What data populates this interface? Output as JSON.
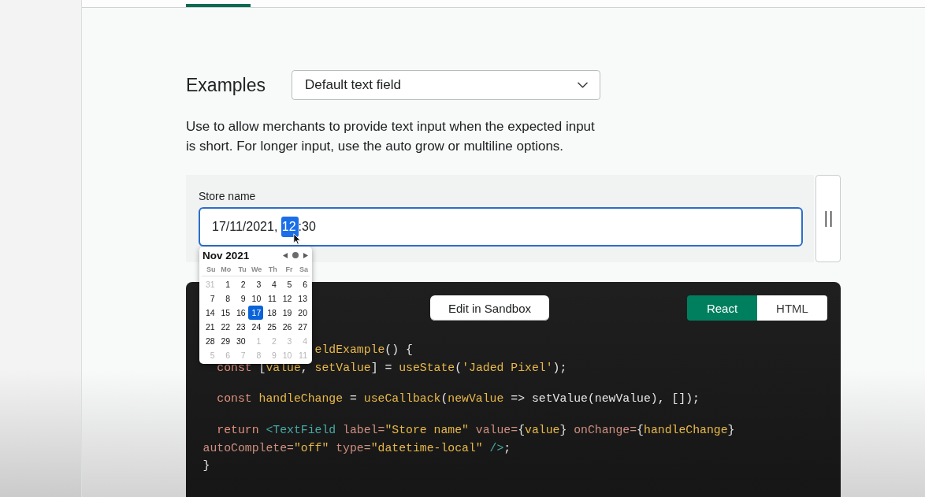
{
  "examples": {
    "heading": "Examples",
    "select": {
      "value": "Default text field"
    },
    "description": "Use to allow merchants to provide text input when the expected input is short. For longer input, use the auto grow or multiline options."
  },
  "preview": {
    "field": {
      "label": "Store name",
      "focused": true,
      "segments": [
        {
          "text": "17/11/2021, ",
          "selected": false
        },
        {
          "text": "12",
          "selected": true
        },
        {
          "text": ":30",
          "selected": false
        }
      ]
    },
    "date_picker": {
      "month": "Nov 2021",
      "weekdays": [
        "Su",
        "Mo",
        "Tu",
        "We",
        "Th",
        "Fr",
        "Sa"
      ],
      "weeks": [
        [
          {
            "day": "31",
            "other_month": true,
            "selected": false
          },
          {
            "day": "1",
            "other_month": false,
            "selected": false
          },
          {
            "day": "2",
            "other_month": false,
            "selected": false
          },
          {
            "day": "3",
            "other_month": false,
            "selected": false
          },
          {
            "day": "4",
            "other_month": false,
            "selected": false
          },
          {
            "day": "5",
            "other_month": false,
            "selected": false
          },
          {
            "day": "6",
            "other_month": false,
            "selected": false
          }
        ],
        [
          {
            "day": "7",
            "other_month": false,
            "selected": false
          },
          {
            "day": "8",
            "other_month": false,
            "selected": false
          },
          {
            "day": "9",
            "other_month": false,
            "selected": false
          },
          {
            "day": "10",
            "other_month": false,
            "selected": false
          },
          {
            "day": "11",
            "other_month": false,
            "selected": false
          },
          {
            "day": "12",
            "other_month": false,
            "selected": false
          },
          {
            "day": "13",
            "other_month": false,
            "selected": false
          }
        ],
        [
          {
            "day": "14",
            "other_month": false,
            "selected": false
          },
          {
            "day": "15",
            "other_month": false,
            "selected": false
          },
          {
            "day": "16",
            "other_month": false,
            "selected": false
          },
          {
            "day": "17",
            "other_month": false,
            "selected": true
          },
          {
            "day": "18",
            "other_month": false,
            "selected": false
          },
          {
            "day": "19",
            "other_month": false,
            "selected": false
          },
          {
            "day": "20",
            "other_month": false,
            "selected": false
          }
        ],
        [
          {
            "day": "21",
            "other_month": false,
            "selected": false
          },
          {
            "day": "22",
            "other_month": false,
            "selected": false
          },
          {
            "day": "23",
            "other_month": false,
            "selected": false
          },
          {
            "day": "24",
            "other_month": false,
            "selected": false
          },
          {
            "day": "25",
            "other_month": false,
            "selected": false
          },
          {
            "day": "26",
            "other_month": false,
            "selected": false
          },
          {
            "day": "27",
            "other_month": false,
            "selected": false
          }
        ],
        [
          {
            "day": "28",
            "other_month": false,
            "selected": false
          },
          {
            "day": "29",
            "other_month": false,
            "selected": false
          },
          {
            "day": "30",
            "other_month": false,
            "selected": false
          },
          {
            "day": "1",
            "other_month": true,
            "selected": false
          },
          {
            "day": "2",
            "other_month": true,
            "selected": false
          },
          {
            "day": "3",
            "other_month": true,
            "selected": false
          },
          {
            "day": "4",
            "other_month": true,
            "selected": false
          }
        ],
        [
          {
            "day": "5",
            "other_month": true,
            "selected": false
          },
          {
            "day": "6",
            "other_month": true,
            "selected": false
          },
          {
            "day": "7",
            "other_month": true,
            "selected": false
          },
          {
            "day": "8",
            "other_month": true,
            "selected": false
          },
          {
            "day": "9",
            "other_month": true,
            "selected": false
          },
          {
            "day": "10",
            "other_month": true,
            "selected": false
          },
          {
            "day": "11",
            "other_month": true,
            "selected": false
          }
        ]
      ]
    }
  },
  "code": {
    "sandbox_button": "Edit in Sandbox",
    "languages": [
      {
        "label": "React",
        "selected": true
      },
      {
        "label": "HTML",
        "selected": false
      }
    ],
    "blocks": [
      {
        "lines": [
          {
            "tokens": [
              {
                "text": "eldExample",
                "kind": "function"
              },
              {
                "text": "() {",
                "kind": "plain"
              }
            ]
          },
          {
            "tokens": [
              {
                "text": "  const",
                "kind": "keyword"
              },
              {
                "text": " [",
                "kind": "plain"
              },
              {
                "text": "value",
                "kind": "function"
              },
              {
                "text": ", ",
                "kind": "plain"
              },
              {
                "text": "setValue",
                "kind": "function"
              },
              {
                "text": "] = ",
                "kind": "plain"
              },
              {
                "text": "useState",
                "kind": "function"
              },
              {
                "text": "(",
                "kind": "plain"
              },
              {
                "text": "'Jaded Pixel'",
                "kind": "string"
              },
              {
                "text": ");",
                "kind": "plain"
              }
            ]
          }
        ]
      },
      {
        "lines": [
          {
            "tokens": [
              {
                "text": "  const ",
                "kind": "keyword"
              },
              {
                "text": "handleChange",
                "kind": "function"
              },
              {
                "text": " = ",
                "kind": "plain"
              },
              {
                "text": "useCallback",
                "kind": "function"
              },
              {
                "text": "(",
                "kind": "plain"
              },
              {
                "text": "newValue",
                "kind": "function"
              },
              {
                "text": " => setValue(newValue), []);",
                "kind": "plain"
              }
            ]
          }
        ]
      },
      {
        "lines": [
          {
            "tokens": [
              {
                "text": "  return ",
                "kind": "keyword"
              },
              {
                "text": "<TextField",
                "kind": "tag"
              },
              {
                "text": " label=",
                "kind": "attr"
              },
              {
                "text": "\"Store name\"",
                "kind": "string"
              },
              {
                "text": " value=",
                "kind": "attr"
              },
              {
                "text": "{",
                "kind": "plain"
              },
              {
                "text": "value",
                "kind": "function"
              },
              {
                "text": "}",
                "kind": "plain"
              },
              {
                "text": " onChange=",
                "kind": "attr"
              },
              {
                "text": "{",
                "kind": "plain"
              },
              {
                "text": "handleChange",
                "kind": "function"
              },
              {
                "text": "}",
                "kind": "plain"
              }
            ]
          },
          {
            "tokens": [
              {
                "text": "autoComplete=",
                "kind": "attr"
              },
              {
                "text": "\"off\"",
                "kind": "string"
              },
              {
                "text": " type=",
                "kind": "attr"
              },
              {
                "text": "\"datetime-local\"",
                "kind": "string"
              },
              {
                "text": " />",
                "kind": "tag"
              },
              {
                "text": ";",
                "kind": "plain"
              }
            ]
          },
          {
            "tokens": [
              {
                "text": "}",
                "kind": "plain"
              }
            ]
          }
        ]
      }
    ]
  }
}
